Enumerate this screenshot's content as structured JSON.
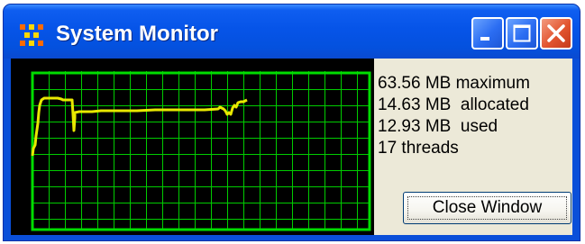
{
  "window": {
    "title": "System Monitor",
    "icon": "network-nodes-icon",
    "controls": {
      "minimize": "minimize-icon",
      "maximize": "maximize-icon",
      "close": "close-icon"
    }
  },
  "stats": {
    "maximum": "63.56 MB maximum",
    "allocated": "14.63 MB  allocated",
    "used": "12.93 MB  used",
    "threads": "17 threads"
  },
  "close_button": {
    "label": "Close Window"
  },
  "graph": {
    "background_color": "#000000",
    "grid_color": "#00cc00",
    "line_color": "#e8e800"
  }
}
